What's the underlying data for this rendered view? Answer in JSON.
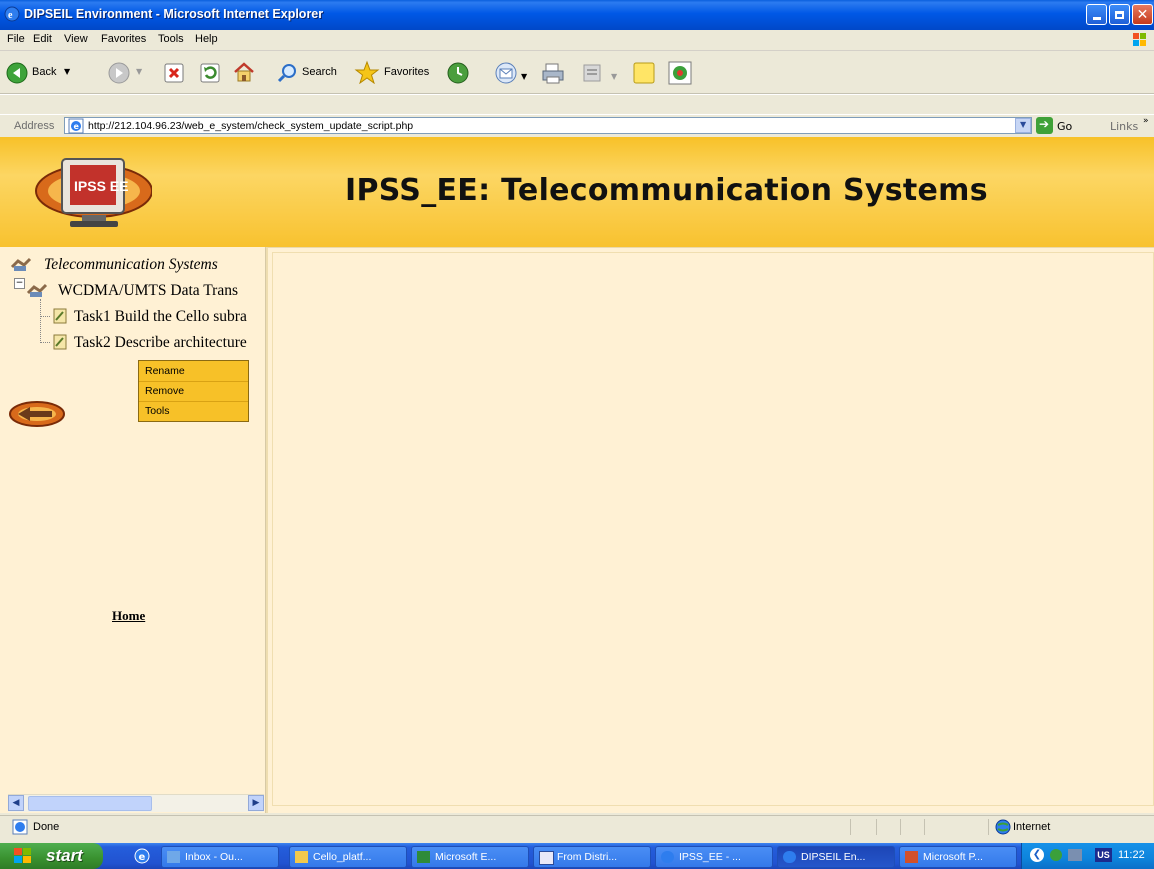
{
  "window": {
    "title": "DIPSEIL Environment - Microsoft Internet Explorer"
  },
  "menubar": {
    "items": [
      "File",
      "Edit",
      "View",
      "Favorites",
      "Tools",
      "Help"
    ]
  },
  "toolbar": {
    "back_label": "Back",
    "search_label": "Search",
    "favorites_label": "Favorites"
  },
  "addressbar": {
    "label": "Address",
    "url": "http://212.104.96.23/web_e_system/check_system_update_script.php",
    "go_label": "Go",
    "links_label": "Links"
  },
  "page": {
    "header_title": "IPSS_EE: Telecommunication Systems",
    "logo_text": "IPSS EE",
    "tree": {
      "root": "Telecommunication Systems",
      "folder": "WCDMA/UMTS Data Trans",
      "tasks": [
        "Task1 Build the Cello subra",
        "Task2 Describe architecture"
      ]
    },
    "context_menu": [
      "Rename",
      "Remove",
      "Tools"
    ],
    "home_link": "Home"
  },
  "statusbar": {
    "status": "Done",
    "zone": "Internet"
  },
  "taskbar": {
    "start_label": "start",
    "tasks": [
      {
        "label": "Inbox - Ou..."
      },
      {
        "label": "Cello_platf..."
      },
      {
        "label": "Microsoft E..."
      },
      {
        "label": "From Distri..."
      },
      {
        "label": "IPSS_EE - ..."
      },
      {
        "label": "DIPSEIL En..."
      },
      {
        "label": "Microsoft P..."
      }
    ],
    "language": "US",
    "clock": "11:22"
  },
  "colors": {
    "xp_blue": "#0058E6",
    "header_orange": "#F7C128",
    "page_background": "#FFF1D4",
    "start_green": "#39912F"
  }
}
